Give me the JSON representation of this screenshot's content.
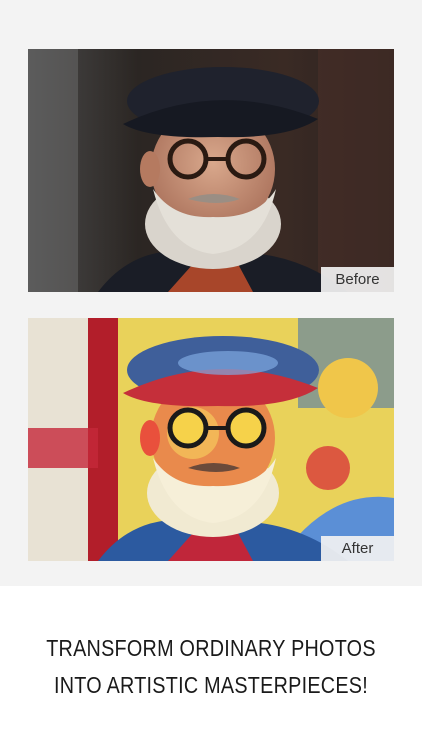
{
  "comparison": {
    "before_label": "Before",
    "after_label": "After"
  },
  "headline": {
    "line1": "TRANSFORM ORDINARY PHOTOS",
    "line2": "INTO ARTISTIC MASTERPIECES!"
  },
  "colors": {
    "panel_background": "#f3f3f3",
    "page_background": "#ffffff",
    "headline_text": "#1a1a1a"
  }
}
